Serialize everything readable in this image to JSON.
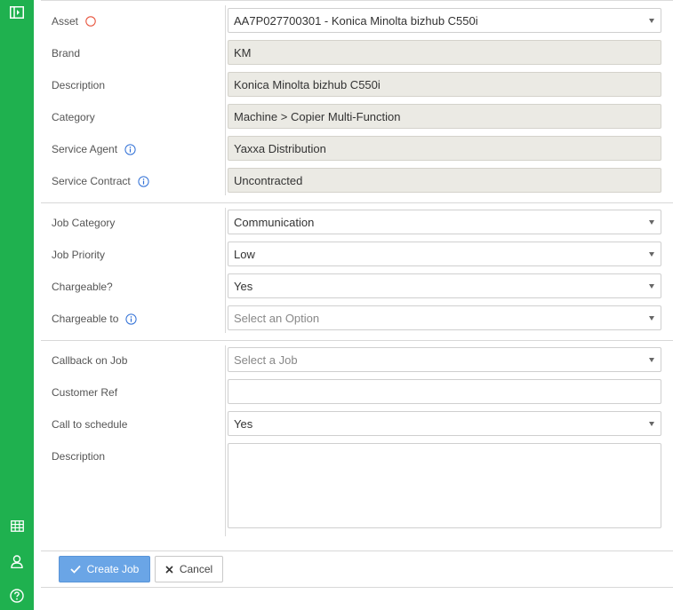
{
  "asset_section": {
    "asset": {
      "label": "Asset",
      "value": "AA7P027700301 - Konica Minolta bizhub C550i"
    },
    "brand": {
      "label": "Brand",
      "value": "KM"
    },
    "description": {
      "label": "Description",
      "value": "Konica Minolta bizhub C550i"
    },
    "category": {
      "label": "Category",
      "value": "Machine > Copier Multi-Function"
    },
    "service_agent": {
      "label": "Service Agent",
      "value": "Yaxxa Distribution"
    },
    "service_contract": {
      "label": "Service Contract",
      "value": "Uncontracted"
    }
  },
  "job_section": {
    "job_category": {
      "label": "Job Category",
      "value": "Communication"
    },
    "job_priority": {
      "label": "Job Priority",
      "value": "Low"
    },
    "chargeable": {
      "label": "Chargeable?",
      "value": "Yes"
    },
    "chargeable_to": {
      "label": "Chargeable to",
      "placeholder": "Select an Option"
    }
  },
  "callback_section": {
    "callback_on_job": {
      "label": "Callback on Job",
      "placeholder": "Select a Job"
    },
    "customer_ref": {
      "label": "Customer Ref",
      "value": ""
    },
    "call_to_schedule": {
      "label": "Call to schedule",
      "value": "Yes"
    },
    "description": {
      "label": "Description",
      "value": ""
    }
  },
  "actions": {
    "create_label": "Create Job",
    "cancel_label": "Cancel"
  },
  "colors": {
    "sidebar": "#1fb14f",
    "primary_button": "#6aa5e6",
    "readonly_field": "#ebeae4",
    "required_indicator": "#e8553e",
    "info_icon": "#2f6fd6"
  },
  "icons": {
    "sidebar_top": "collapse-panel-icon",
    "sidebar_bottom": [
      "grid-icon",
      "user-icon",
      "help-icon"
    ],
    "info": "info-icon",
    "required": "required-indicator-icon",
    "create": "check-icon",
    "cancel": "close-icon"
  }
}
